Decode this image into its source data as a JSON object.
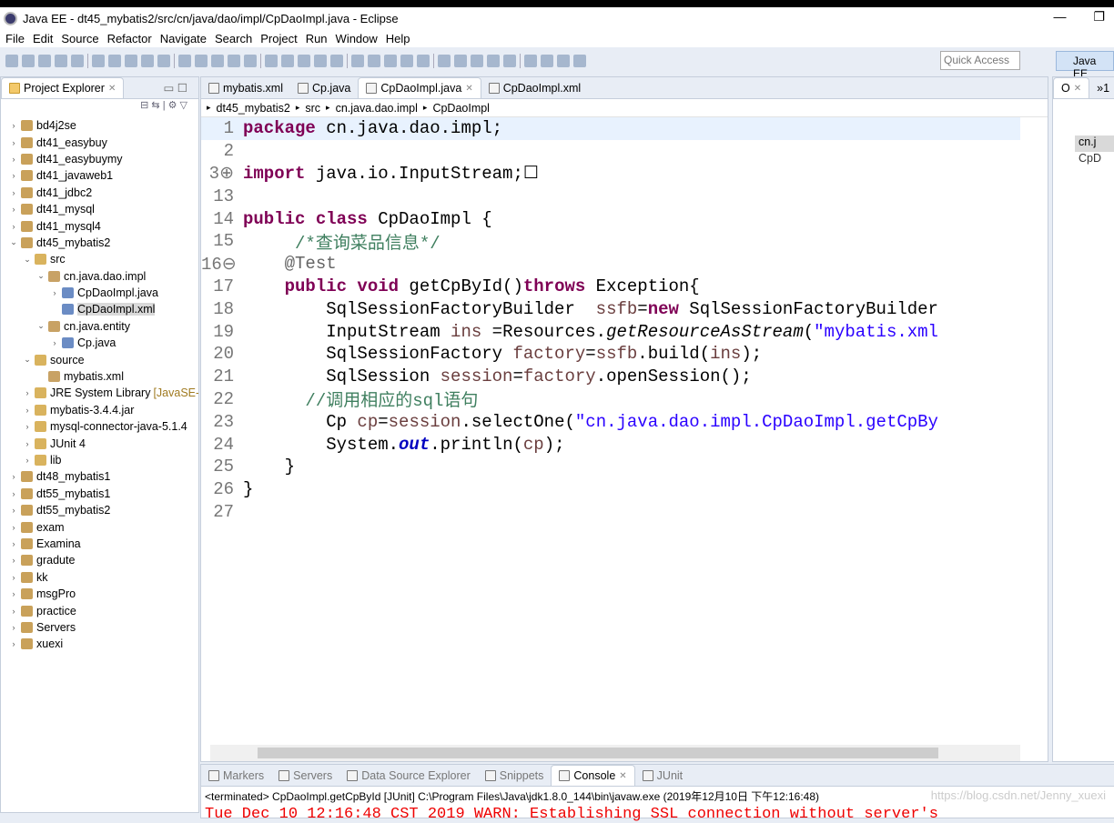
{
  "window": {
    "title": "Java EE - dt45_mybatis2/src/cn/java/dao/impl/CpDaoImpl.java - Eclipse",
    "minimize": "—",
    "restore": "❐"
  },
  "menu": [
    "File",
    "Edit",
    "Source",
    "Refactor",
    "Navigate",
    "Search",
    "Project",
    "Run",
    "Window",
    "Help"
  ],
  "toolbar": {
    "quick_access_placeholder": "Quick Access",
    "perspective": "Java EE"
  },
  "explorer": {
    "title": "Project Explorer",
    "items": [
      {
        "label": "bd4j2se",
        "level": 0,
        "arrow": "›"
      },
      {
        "label": "dt41_easybuy",
        "level": 0,
        "arrow": "›"
      },
      {
        "label": "dt41_easybuymy",
        "level": 0,
        "arrow": "›"
      },
      {
        "label": "dt41_javaweb1",
        "level": 0,
        "arrow": "›"
      },
      {
        "label": "dt41_jdbc2",
        "level": 0,
        "arrow": "›"
      },
      {
        "label": "dt41_mysql",
        "level": 0,
        "arrow": "›"
      },
      {
        "label": "dt41_mysql4",
        "level": 0,
        "arrow": "›"
      },
      {
        "label": "dt45_mybatis2",
        "level": 0,
        "arrow": "⌄"
      },
      {
        "label": "src",
        "level": 1,
        "arrow": "⌄"
      },
      {
        "label": "cn.java.dao.impl",
        "level": 2,
        "arrow": "⌄"
      },
      {
        "label": "CpDaoImpl.java",
        "level": 3,
        "arrow": "›"
      },
      {
        "label": "CpDaoImpl.xml",
        "level": 3,
        "arrow": "",
        "selected": true
      },
      {
        "label": "cn.java.entity",
        "level": 2,
        "arrow": "⌄"
      },
      {
        "label": "Cp.java",
        "level": 3,
        "arrow": "›"
      },
      {
        "label": "source",
        "level": 1,
        "arrow": "⌄"
      },
      {
        "label": "mybatis.xml",
        "level": 2,
        "arrow": ""
      },
      {
        "label": "JRE System Library",
        "suffix": "[JavaSE-",
        "level": 1,
        "arrow": "›"
      },
      {
        "label": "mybatis-3.4.4.jar",
        "level": 1,
        "arrow": "›"
      },
      {
        "label": "mysql-connector-java-5.1.4",
        "level": 1,
        "arrow": "›"
      },
      {
        "label": "JUnit 4",
        "level": 1,
        "arrow": "›"
      },
      {
        "label": "lib",
        "level": 1,
        "arrow": "›"
      },
      {
        "label": "dt48_mybatis1",
        "level": 0,
        "arrow": "›"
      },
      {
        "label": "dt55_mybatis1",
        "level": 0,
        "arrow": "›"
      },
      {
        "label": "dt55_mybatis2",
        "level": 0,
        "arrow": "›"
      },
      {
        "label": "exam",
        "level": 0,
        "arrow": "›"
      },
      {
        "label": "Examina",
        "level": 0,
        "arrow": "›"
      },
      {
        "label": "gradute",
        "level": 0,
        "arrow": "›"
      },
      {
        "label": "kk",
        "level": 0,
        "arrow": "›"
      },
      {
        "label": "msgPro",
        "level": 0,
        "arrow": "›"
      },
      {
        "label": "practice",
        "level": 0,
        "arrow": "›"
      },
      {
        "label": "Servers",
        "level": 0,
        "arrow": "›"
      },
      {
        "label": "xuexi",
        "level": 0,
        "arrow": "›"
      }
    ]
  },
  "editor": {
    "tabs": [
      {
        "label": "mybatis.xml"
      },
      {
        "label": "Cp.java"
      },
      {
        "label": "CpDaoImpl.java",
        "active": true
      },
      {
        "label": "CpDaoImpl.xml"
      }
    ],
    "breadcrumb": [
      "dt45_mybatis2",
      "src",
      "cn.java.dao.impl",
      "CpDaoImpl"
    ],
    "lines": [
      {
        "n": "1",
        "cur": true,
        "t": [
          [
            "package",
            "kw"
          ],
          [
            " cn.java.dao.impl;",
            ""
          ]
        ]
      },
      {
        "n": "2",
        "t": []
      },
      {
        "n": "3⊕",
        "t": [
          [
            "import",
            "kw"
          ],
          [
            " java.io.InputStream;",
            ""
          ],
          [
            "☐",
            ""
          ]
        ]
      },
      {
        "n": "13",
        "t": []
      },
      {
        "n": "14",
        "t": [
          [
            "public class",
            "kw"
          ],
          [
            " CpDaoImpl {",
            ""
          ]
        ]
      },
      {
        "n": "15",
        "t": [
          [
            "     /*查询菜品信息*/",
            "cm"
          ]
        ]
      },
      {
        "n": "16⊖",
        "t": [
          [
            "    @Test",
            "an"
          ]
        ]
      },
      {
        "n": "17",
        "t": [
          [
            "    ",
            ""
          ],
          [
            "public void",
            "kw"
          ],
          [
            " getCpById()",
            ""
          ],
          [
            "throws",
            "kw"
          ],
          [
            " Exception{",
            ""
          ]
        ]
      },
      {
        "n": "18",
        "t": [
          [
            "        SqlSessionFactoryBuilder  ",
            ""
          ],
          [
            "ssfb",
            "var"
          ],
          [
            "=",
            ""
          ],
          [
            "new",
            "kw"
          ],
          [
            " SqlSessionFactoryBuilder",
            ""
          ]
        ]
      },
      {
        "n": "19",
        "t": [
          [
            "        InputStream ",
            ""
          ],
          [
            "ins",
            "var"
          ],
          [
            " =Resources.",
            ""
          ],
          [
            "getResourceAsStream",
            "it"
          ],
          [
            "(",
            ""
          ],
          [
            "\"mybatis.xml",
            "str"
          ]
        ]
      },
      {
        "n": "20",
        "t": [
          [
            "        SqlSessionFactory ",
            ""
          ],
          [
            "factory",
            "var"
          ],
          [
            "=",
            ""
          ],
          [
            "ssfb",
            "var"
          ],
          [
            ".build(",
            ""
          ],
          [
            "ins",
            "var"
          ],
          [
            ");",
            ""
          ]
        ]
      },
      {
        "n": "21",
        "t": [
          [
            "        SqlSession ",
            ""
          ],
          [
            "session",
            "var"
          ],
          [
            "=",
            ""
          ],
          [
            "factory",
            "var"
          ],
          [
            ".openSession();",
            ""
          ]
        ]
      },
      {
        "n": "22",
        "t": [
          [
            "      //调用相应的sql语句",
            "cm"
          ]
        ]
      },
      {
        "n": "23",
        "t": [
          [
            "        Cp ",
            ""
          ],
          [
            "cp",
            "var"
          ],
          [
            "=",
            ""
          ],
          [
            "session",
            "var"
          ],
          [
            ".selectOne(",
            ""
          ],
          [
            "\"cn.java.dao.impl.CpDaoImpl.getCpBy",
            "str"
          ]
        ]
      },
      {
        "n": "24",
        "t": [
          [
            "        System.",
            ""
          ],
          [
            "out",
            "st"
          ],
          [
            ".println(",
            ""
          ],
          [
            "cp",
            "var"
          ],
          [
            ");",
            ""
          ]
        ]
      },
      {
        "n": "25",
        "t": [
          [
            "    }",
            ""
          ]
        ]
      },
      {
        "n": "26",
        "t": [
          [
            "}",
            ""
          ]
        ]
      },
      {
        "n": "27",
        "t": []
      }
    ]
  },
  "outline": {
    "tab": "O",
    "more": "»1",
    "items": [
      "cn.j",
      "CpD"
    ]
  },
  "bottom": {
    "tabs": [
      {
        "label": "Markers"
      },
      {
        "label": "Servers"
      },
      {
        "label": "Data Source Explorer"
      },
      {
        "label": "Snippets"
      },
      {
        "label": "Console",
        "active": true
      },
      {
        "label": "JUnit"
      }
    ],
    "status": "<terminated> CpDaoImpl.getCpById [JUnit] C:\\Program Files\\Java\\jdk1.8.0_144\\bin\\javaw.exe (2019年12月10日 下午12:16:48)",
    "output": "Tue Dec 10 12:16:48 CST 2019 WARN: Establishing SSL connection without server's",
    "watermark": "https://blog.csdn.net/Jenny_xuexi"
  },
  "colors": {
    "keyword": "#7f0055",
    "string": "#2a00ff",
    "comment": "#3f7f5f",
    "console_error": "#e00000"
  }
}
